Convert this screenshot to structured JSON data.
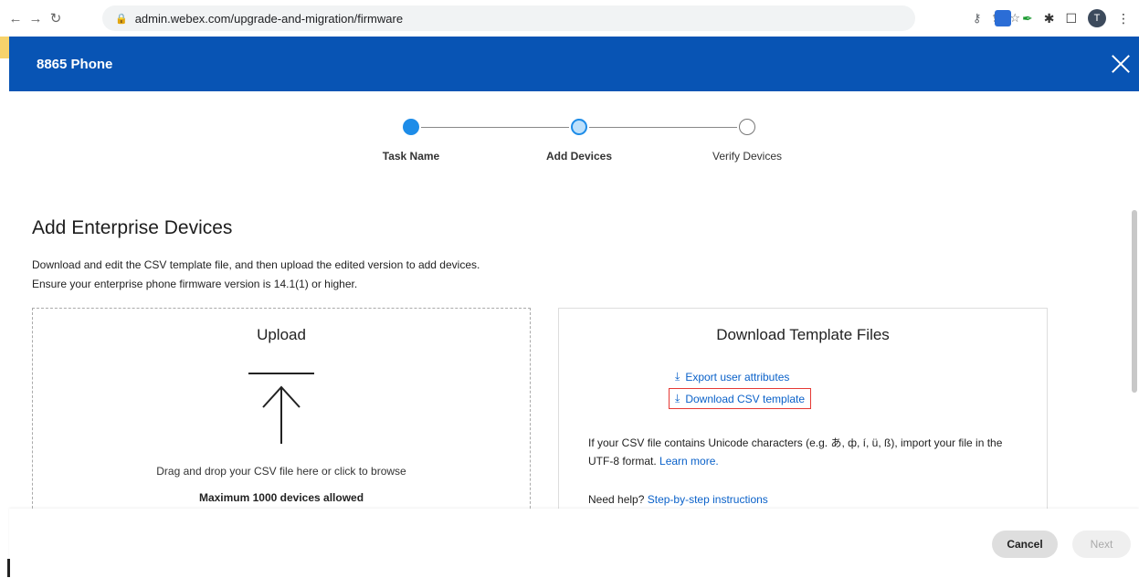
{
  "browser": {
    "url": "admin.webex.com/upgrade-and-migration/firmware",
    "profile_initial": "T"
  },
  "modal": {
    "title": "8865 Phone"
  },
  "stepper": {
    "steps": [
      {
        "label": "Task Name",
        "state": "completed"
      },
      {
        "label": "Add Devices",
        "state": "current"
      },
      {
        "label": "Verify Devices",
        "state": "pending"
      }
    ]
  },
  "main": {
    "title": "Add Enterprise Devices",
    "desc_line_1": "Download and edit the CSV template file, and then upload the edited version to add devices.",
    "desc_line_2": "Ensure your enterprise phone firmware version is 14.1(1) or higher."
  },
  "upload": {
    "title": "Upload",
    "hint": "Drag and drop your CSV file here or click to browse",
    "limit": "Maximum 1000 devices allowed"
  },
  "template": {
    "title": "Download Template Files",
    "export_link": "Export user attributes",
    "download_link": "Download CSV template",
    "unicode_note": "If your CSV file contains Unicode characters (e.g. あ, ф, í, ü, ß), import your file in the UTF-8 format.",
    "learn_more": "Learn more.",
    "help_prefix": "Need help?",
    "help_link": "Step-by-step instructions"
  },
  "footer": {
    "cancel_label": "Cancel",
    "next_label": "Next"
  },
  "colors": {
    "header_blue": "#0854b4",
    "link_blue": "#0a61c9",
    "step_blue": "#1d8ce8",
    "highlight_red": "#e53935"
  }
}
